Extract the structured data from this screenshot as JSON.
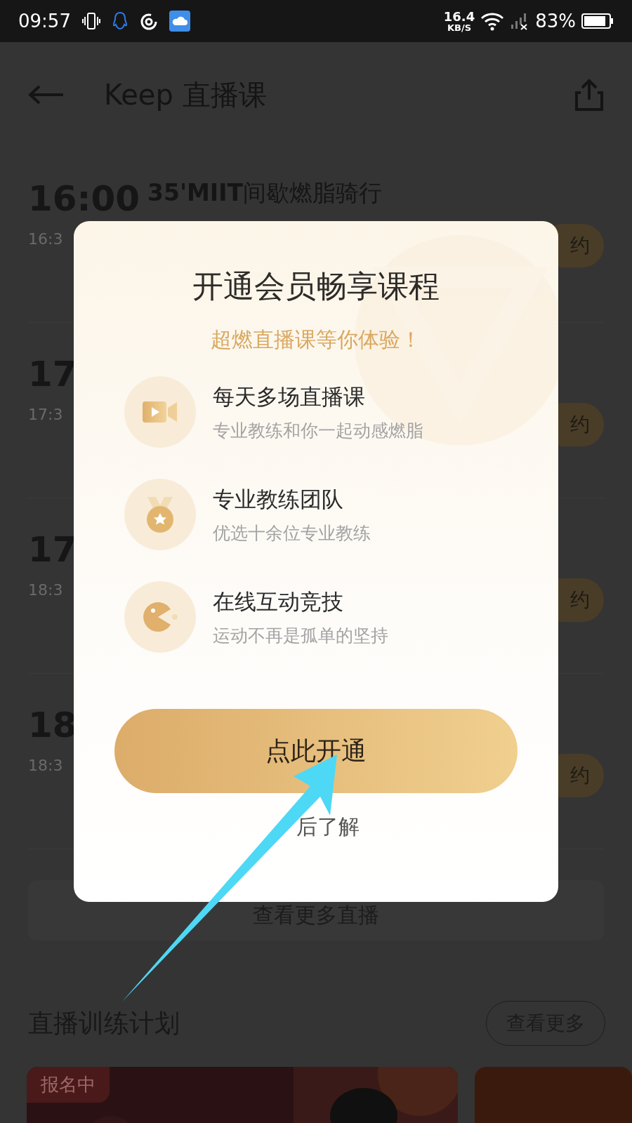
{
  "status_bar": {
    "time": "09:57",
    "speed": "16.4",
    "speed_unit": "KB/S",
    "battery": "83%"
  },
  "header": {
    "title": "Keep 直播课"
  },
  "classes": [
    {
      "time": "16:00",
      "title": "**35'MIIT**间歇燃脂骑行",
      "end": "16:3",
      "action": "约"
    },
    {
      "time": "17",
      "end": "17:3",
      "action": "约"
    },
    {
      "time": "17",
      "end": "18:3",
      "action": "约"
    },
    {
      "time": "18",
      "end": "18:3",
      "action": "约"
    }
  ],
  "more_live": "查看更多直播",
  "plans": {
    "title": "直播训练计划",
    "more": "查看更多",
    "cards": [
      {
        "badge": "报名中",
        "kind": "picture"
      }
    ]
  },
  "dialog": {
    "title": "开通会员畅享课程",
    "subtitle": "超燃直播课等你体验！",
    "features": [
      {
        "kind": "video",
        "title": "每天多场直播课",
        "desc": "专业教练和你一起动感燃脂"
      },
      {
        "kind": "medal",
        "title": "专业教练团队",
        "desc": "优选十余位专业教练"
      },
      {
        "kind": "pacman",
        "title": "在线互动竞技",
        "desc": "运动不再是孤单的坚持"
      }
    ],
    "primary": "点此开通",
    "secondary": "后了解"
  }
}
